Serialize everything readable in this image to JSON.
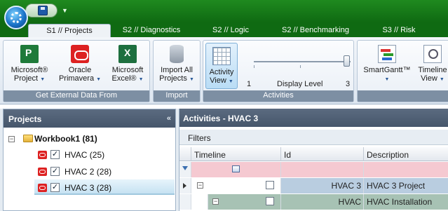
{
  "colors": {
    "title_bar": "#0f6a12",
    "ribbon_group_label": "#7d8fa3",
    "panel_header": "#4f5f74",
    "filter_row": "#f5c9d1",
    "project_row": "#b9cde0",
    "installation_row": "#a7c2b4"
  },
  "qat": {
    "save_icon": "save-icon",
    "customize_icon": "chevron-down-icon"
  },
  "tabs": [
    {
      "label": "S1 // Projects",
      "active": true
    },
    {
      "label": "S2 // Diagnostics"
    },
    {
      "label": "S2 // Logic"
    },
    {
      "label": "S2 // Benchmarking"
    },
    {
      "label": "S3 // Risk"
    }
  ],
  "ribbon": {
    "groups": [
      {
        "label": "Get External Data From",
        "buttons": [
          {
            "label1": "Microsoft®",
            "label2": "Project",
            "icon": "ms-project-icon"
          },
          {
            "label1": "Oracle",
            "label2": "Primavera",
            "icon": "oracle-icon"
          },
          {
            "label1": "Microsoft",
            "label2": "Excel®",
            "icon": "excel-icon"
          }
        ]
      },
      {
        "label": "Import",
        "buttons": [
          {
            "label1": "Import All",
            "label2": "Projects",
            "icon": "database-icon"
          }
        ]
      },
      {
        "label": "Activities",
        "activity_view": {
          "label1": "Activity",
          "label2": "View",
          "icon": "grid-icon"
        },
        "display_level": {
          "label": "Display Level",
          "min": "1",
          "max": "3",
          "value": 3
        }
      },
      {
        "label": "",
        "buttons": [
          {
            "label1": "SmartGantt™",
            "label2": "",
            "icon": "gantt-icon"
          },
          {
            "label1": "Timeline",
            "label2": "View",
            "icon": "timeline-icon"
          }
        ]
      }
    ]
  },
  "projects_panel": {
    "title": "Projects",
    "workbook": {
      "label": "Workbook1 (81)"
    },
    "items": [
      {
        "label": "HVAC (25)",
        "checked": true
      },
      {
        "label": "HVAC 2 (28)",
        "checked": true
      },
      {
        "label": "HVAC 3 (28)",
        "checked": true,
        "selected": true
      }
    ]
  },
  "activities_panel": {
    "title": "Activities - HVAC 3",
    "filters_label": "Filters",
    "columns": [
      "Timeline",
      "Id",
      "Description"
    ],
    "rows": [
      {
        "id": "HVAC 3",
        "description": "HVAC 3 Project"
      },
      {
        "id": "HVAC",
        "description": "HVAC Installation"
      }
    ]
  }
}
